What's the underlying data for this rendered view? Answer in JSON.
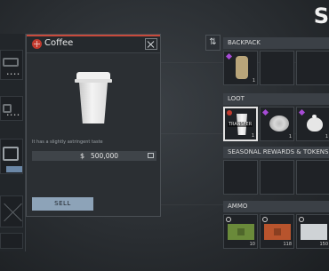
{
  "item_modal": {
    "title": "Coffee",
    "description": "It has a slightly astringent taste",
    "price": "500,000",
    "currency_icon": "$",
    "sell_label": "SELL",
    "rarity_color": "#c13a2e"
  },
  "header": {
    "letter": "S"
  },
  "sections": {
    "backpack": {
      "title": "BACKPACK",
      "items": [
        {
          "icon": "backpack-item",
          "count": "1"
        }
      ]
    },
    "loot": {
      "title": "LOOT",
      "items": [
        {
          "icon": "coffee-cup",
          "count": "1",
          "tag": "TRANSFER"
        },
        {
          "icon": "plate",
          "count": "1"
        },
        {
          "icon": "teapot",
          "count": "1"
        }
      ]
    },
    "seasonal": {
      "title": "SEASONAL REWARDS & TOKENS"
    },
    "ammo": {
      "title": "AMMO",
      "items": [
        {
          "icon": "ammo-box-green",
          "count": "10"
        },
        {
          "icon": "ammo-box-red",
          "count": "118"
        },
        {
          "icon": "ammo-box-white",
          "count": "150"
        }
      ]
    }
  },
  "colors": {
    "accent": "#c84a3c",
    "sell_button": "#8da3b8",
    "rarity_purple": "#a74bd6"
  }
}
